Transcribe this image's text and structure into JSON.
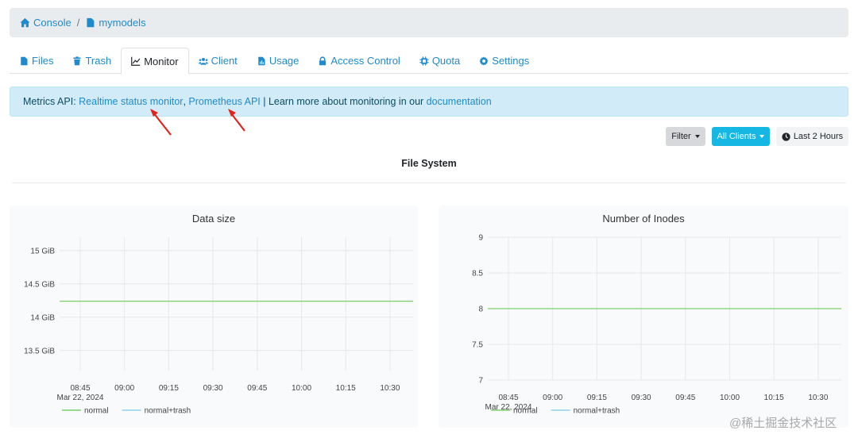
{
  "breadcrumb": {
    "items": [
      {
        "label": "Console",
        "icon": "home-icon"
      },
      {
        "label": "mymodels",
        "icon": "file-icon"
      }
    ],
    "separator": "/"
  },
  "tabs": [
    {
      "label": "Files",
      "icon": "file-icon",
      "active": false
    },
    {
      "label": "Trash",
      "icon": "trash-icon",
      "active": false
    },
    {
      "label": "Monitor",
      "icon": "line-chart-icon",
      "active": true
    },
    {
      "label": "Client",
      "icon": "users-icon",
      "active": false
    },
    {
      "label": "Usage",
      "icon": "file-chart-icon",
      "active": false
    },
    {
      "label": "Access Control",
      "icon": "lock-icon",
      "active": false
    },
    {
      "label": "Quota",
      "icon": "chip-icon",
      "active": false
    },
    {
      "label": "Settings",
      "icon": "gear-icon",
      "active": false
    }
  ],
  "alert": {
    "prefix": "Metrics API: ",
    "link1": "Realtime status monitor",
    "comma": ", ",
    "link2": "Prometheus API",
    "middle": " | Learn more about monitoring in our ",
    "link3": "documentation"
  },
  "toolbar": {
    "filter_label": "Filter",
    "clients_label": "All Clients",
    "time_label": "Last 2 Hours"
  },
  "section": {
    "title": "File System"
  },
  "colors": {
    "normal": "#7ccf6b",
    "normal_trash": "#8fd2ec",
    "link": "#1f8acc",
    "primary": "#17b7e3"
  },
  "watermark": "@稀土掘金技术社区",
  "chart_data": [
    {
      "type": "line",
      "title": "Data size",
      "x": [
        "08:45",
        "09:00",
        "09:15",
        "09:30",
        "09:45",
        "10:00",
        "10:15",
        "10:30"
      ],
      "x_date": "Mar 22, 2024",
      "yticks": [
        "13.5 GiB",
        "14 GiB",
        "14.5 GiB",
        "15 GiB"
      ],
      "ytick_values": [
        13.5,
        14,
        14.5,
        15
      ],
      "ylim": [
        13.2,
        15.2
      ],
      "series": [
        {
          "name": "normal",
          "values": [
            14.24,
            14.24,
            14.24,
            14.24,
            14.24,
            14.24,
            14.24,
            14.24
          ]
        }
      ],
      "legend": [
        "normal",
        "normal+trash"
      ],
      "legend_placement": "bottom-left",
      "grid": true
    },
    {
      "type": "line",
      "title": "Number of Inodes",
      "x": [
        "08:45",
        "09:00",
        "09:15",
        "09:30",
        "09:45",
        "10:00",
        "10:15",
        "10:30"
      ],
      "x_date": "Mar 22, 2024",
      "yticks": [
        "7",
        "7.5",
        "8",
        "8.5",
        "9"
      ],
      "ytick_values": [
        7,
        7.5,
        8,
        8.5,
        9
      ],
      "ylim": [
        7,
        9
      ],
      "series": [
        {
          "name": "normal",
          "values": [
            8,
            8,
            8,
            8,
            8,
            8,
            8,
            8
          ]
        }
      ],
      "legend": [
        "normal",
        "normal+trash"
      ],
      "legend_placement": "bottom-left",
      "grid": true
    }
  ]
}
